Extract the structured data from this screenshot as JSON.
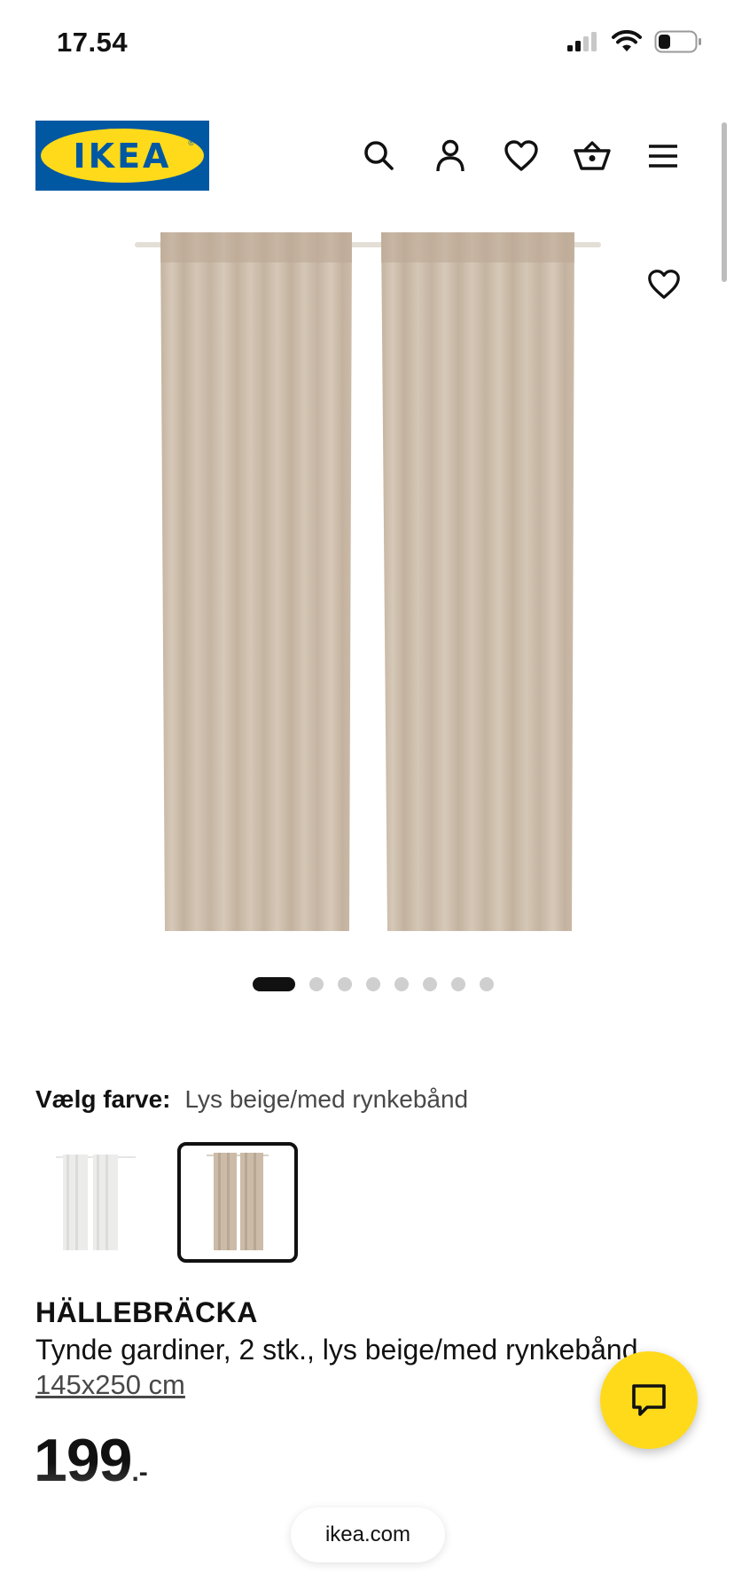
{
  "status_bar": {
    "time": "17.54"
  },
  "header": {
    "logo_text": "IKEA",
    "logo_registered": "®",
    "icons": [
      "search-icon",
      "account-icon",
      "heart-icon",
      "basket-icon",
      "menu-icon"
    ]
  },
  "gallery": {
    "favorite_icon": "heart-icon",
    "dot_count": 8,
    "active_dot": 1
  },
  "color_selector": {
    "label": "Vælg farve:",
    "value": "Lys beige/med rynkebånd",
    "options": [
      {
        "name": "white-curtain-swatch",
        "selected": false,
        "color": "#ececea"
      },
      {
        "name": "beige-curtain-swatch",
        "selected": true,
        "color": "#cbbba8"
      }
    ]
  },
  "product": {
    "name": "HÄLLEBRÄCKA",
    "description": "Tynde gardiner, 2 stk., lys beige/med rynkebånd,",
    "size": "145x250 cm",
    "price": "199",
    "price_suffix": ".-"
  },
  "browser": {
    "url": "ikea.com"
  },
  "colors": {
    "ikea_blue": "#0058a3",
    "ikea_yellow": "#ffda1a",
    "curtain_beige": "#cbbba8"
  }
}
